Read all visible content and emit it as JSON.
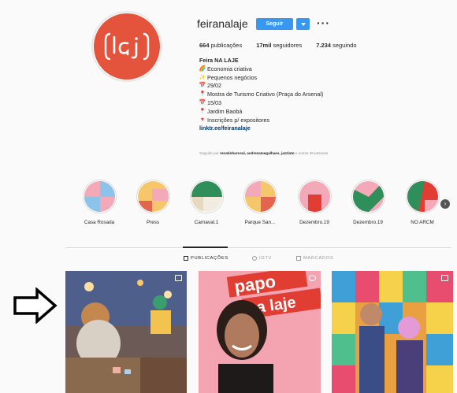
{
  "profile": {
    "username": "feiranalaje",
    "follow_label": "Seguir",
    "more_label": "···",
    "avatar_text": "laj",
    "brand_color": "#e4533c",
    "button_color": "#3897f0"
  },
  "stats": {
    "posts_count": "664",
    "posts_label": "publicações",
    "followers_count": "17mil",
    "followers_label": "seguidores",
    "following_count": "7.234",
    "following_label": "seguindo"
  },
  "bio": {
    "name": "Feira NA LAJE",
    "lines": [
      {
        "icon": "rainbow-icon",
        "glyph": "🌈",
        "text": "Economia criativa"
      },
      {
        "icon": "sparkles-icon",
        "glyph": "✨",
        "text": "Pequenos negócios"
      },
      {
        "icon": "calendar-icon",
        "glyph": "📅",
        "text": "29/02"
      },
      {
        "icon": "pin-icon",
        "glyph": "📍",
        "text": "Mostra de Turismo Criativo (Praça do Arsenal)"
      },
      {
        "icon": "calendar-icon",
        "glyph": "📅",
        "text": "15/03"
      },
      {
        "icon": "pin-icon",
        "glyph": "📍",
        "text": "Jardim Baobá"
      },
      {
        "icon": "triangle-down-icon",
        "glyph": "🔻",
        "text": "Inscrições p/ expositores"
      }
    ],
    "link": "linktr.ee/feiranalaje",
    "followed_prefix": "Seguido por",
    "followed_names": "renatinharosal, andrezamegalhaes, jazzlato",
    "followed_suffix": "e outras 36 pessoas"
  },
  "highlights": [
    {
      "label": "Casa Rosada"
    },
    {
      "label": "Press"
    },
    {
      "label": "Carnaval.1"
    },
    {
      "label": "Parque San..."
    },
    {
      "label": "Dezembro.19"
    },
    {
      "label": "Dezembro.19"
    },
    {
      "label": "NO ARCM"
    }
  ],
  "tabs": [
    {
      "label": "PUBLICAÇÕES",
      "icon": "grid-icon",
      "active": true
    },
    {
      "label": "IGTV",
      "icon": "igtv-icon",
      "active": false
    },
    {
      "label": "MARCADOS",
      "icon": "tagged-icon",
      "active": false
    }
  ],
  "posts": {
    "post2_text_line1": "papo",
    "post2_text_line2": "na laje"
  }
}
